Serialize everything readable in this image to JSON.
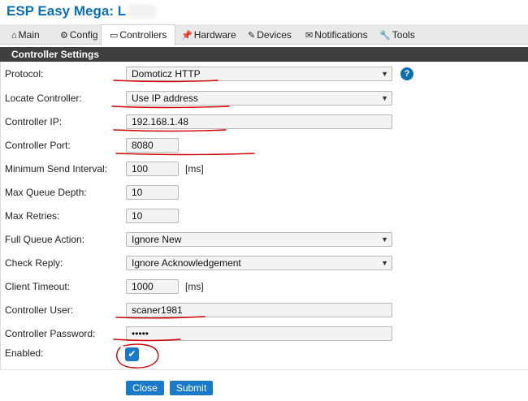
{
  "app": {
    "title": "ESP Easy Mega: L"
  },
  "tabs": [
    {
      "label": "Main",
      "icon": "house-icon"
    },
    {
      "label": "Config",
      "icon": "gear-icon"
    },
    {
      "label": "Controllers",
      "icon": "chat-icon"
    },
    {
      "label": "Hardware",
      "icon": "pin-icon"
    },
    {
      "label": "Devices",
      "icon": "plug-icon"
    },
    {
      "label": "Notifications",
      "icon": "envelope-icon"
    },
    {
      "label": "Tools",
      "icon": "wrench-icon"
    }
  ],
  "section": {
    "title": "Controller Settings"
  },
  "form": {
    "protocol": {
      "label": "Protocol:",
      "value": "Domoticz HTTP"
    },
    "locate": {
      "label": "Locate Controller:",
      "value": "Use IP address"
    },
    "ip": {
      "label": "Controller IP:",
      "value": "192.168.1.48"
    },
    "port": {
      "label": "Controller Port:",
      "value": "8080"
    },
    "min_interval": {
      "label": "Minimum Send Interval:",
      "value": "100",
      "unit": "[ms]"
    },
    "queue_depth": {
      "label": "Max Queue Depth:",
      "value": "10"
    },
    "retries": {
      "label": "Max Retries:",
      "value": "10"
    },
    "queue_action": {
      "label": "Full Queue Action:",
      "value": "Ignore New"
    },
    "check_reply": {
      "label": "Check Reply:",
      "value": "Ignore Acknowledgement"
    },
    "timeout": {
      "label": "Client Timeout:",
      "value": "1000",
      "unit": "[ms]"
    },
    "user": {
      "label": "Controller User:",
      "value": "scaner1981"
    },
    "password": {
      "label": "Controller Password:",
      "value": "•••••"
    },
    "enabled": {
      "label": "Enabled:",
      "checked": true
    }
  },
  "help": {
    "symbol": "?"
  },
  "buttons": {
    "close": "Close",
    "submit": "Submit"
  },
  "colors": {
    "accent": "#1a7ac7",
    "title": "#0a6fb3",
    "annotation": "#d00000"
  }
}
